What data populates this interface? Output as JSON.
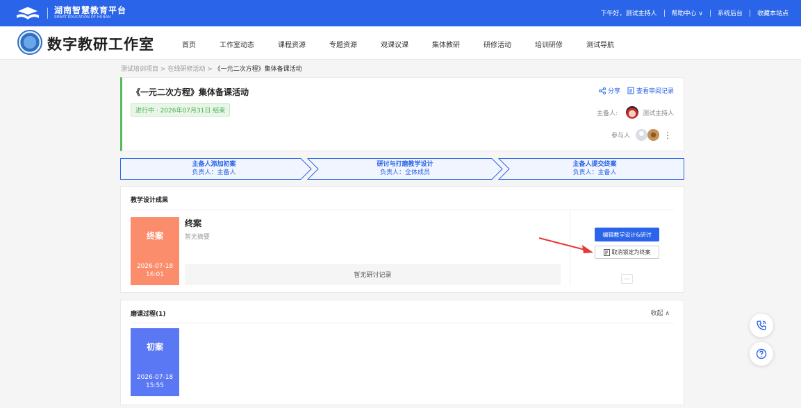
{
  "topbar": {
    "brand": "湖南智慧教育平台",
    "brand_en": "SMART EDUCATION OF HUNAN",
    "greeting": "下午好，测试主持人",
    "help": "帮助中心 ∨",
    "admin": "系统后台",
    "bookmark": "收藏本站点"
  },
  "header": {
    "studio_name": "数字教研工作室",
    "nav": [
      "首页",
      "工作室动态",
      "课程资源",
      "专题资源",
      "观课议课",
      "集体教研",
      "研修活动",
      "培训研修",
      "测试导航"
    ]
  },
  "breadcrumb": {
    "items": [
      "测试培训项目",
      "在线研修活动"
    ],
    "sep": ">",
    "current": "《一元二次方程》集体备课活动"
  },
  "activity": {
    "title": "《一元二次方程》集体备课活动",
    "status": "进行中 · 2026年07月31日 结束",
    "share": "分享",
    "view_record": "查看审阅记录",
    "host_label": "主备人:",
    "host_name": "测试主持人",
    "participants_label": "参与人"
  },
  "steps": [
    {
      "name": "主备人添加初案",
      "owner": "负责人：主备人"
    },
    {
      "name": "研讨与打磨教学设计",
      "owner": "负责人：全体成员"
    },
    {
      "name": "主备人提交终案",
      "owner": "负责人：主备人"
    }
  ],
  "result": {
    "section_title": "教学设计成果",
    "thumb_label": "终案",
    "thumb_date": "2026-07-18",
    "thumb_time": "16:01",
    "file_name": "终案",
    "summary": "暂无摘要",
    "no_record": "暂无研讨记录",
    "edit_button": "编辑教学设计&研讨",
    "cancel_button": "取消锁定为终案",
    "more": "···"
  },
  "process": {
    "section_title": "磨课过程(1)",
    "collapse": "收起 ∧",
    "thumb_label": "初案",
    "thumb_date": "2026-07-18",
    "thumb_time": "15:55"
  },
  "colors": {
    "primary": "#2a64e8",
    "final": "#fb8d6c",
    "draft": "#5b78f4",
    "status_green": "#4caf50",
    "arrow_red": "#e53935"
  }
}
